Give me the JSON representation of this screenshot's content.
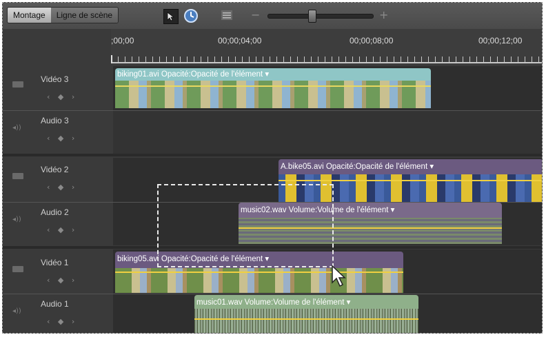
{
  "tabs": {
    "montage": "Montage",
    "ligne": "Ligne de scène"
  },
  "icons": {
    "select": "pointer-arrow-icon",
    "time": "time-stretch-icon",
    "list": "list-icon",
    "zoom_out": "zoom-out-icon",
    "zoom_in": "zoom-in-icon"
  },
  "zoom": {
    "minus": "−",
    "plus": "+",
    "level": 0.45
  },
  "ruler": {
    "t0": ";00;00",
    "t1": "00;00;04;00",
    "t2": "00;00;08;00",
    "t3": "00;00;12;00"
  },
  "tracks": {
    "v3": "Vidéo 3",
    "a3": "Audio 3",
    "v2": "Vidéo 2",
    "a2": "Audio 2",
    "v1": "Vidéo 1",
    "a1": "Audio 1"
  },
  "keyframe_nav": "‹ ◆ ›",
  "clips": {
    "biking01": "biking01.avi  Opacité:Opacité de l'élément ▾",
    "bike05": "A.bike05.avi  Opacité:Opacité de l'élément ▾",
    "music02": "music02.wav  Volume:Volume de l'élément ▾",
    "biking05": "biking05.avi  Opacité:Opacité de l'élément ▾",
    "music01": "music01.wav  Volume:Volume de l'élément ▾"
  },
  "colors": {
    "video_clip_teal": "#8fc6c6",
    "video_clip_purple": "#6b5a80",
    "audio_clip_purple": "#7a6a8a",
    "audio_clip_green": "#8fb08a",
    "keyframe_line": "#f0d040"
  }
}
